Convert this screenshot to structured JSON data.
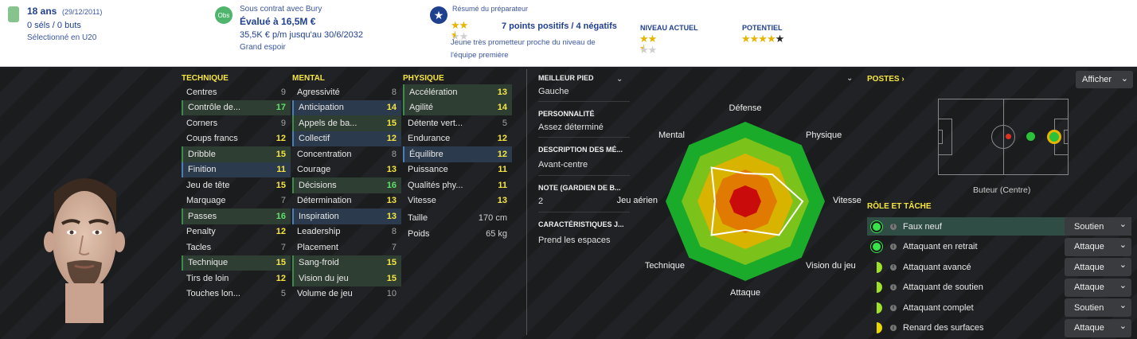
{
  "header": {
    "age": "18 ans",
    "dob": "(29/12/2011)",
    "caps": "0 séls / 0 buts",
    "selection": "Sélectionné en U20",
    "obs_badge": "Obs",
    "contract_line": "Sous contrat avec Bury",
    "valuation": "Évalué à 16,5M €",
    "wage": "35,5K € p/m jusqu'au 30/6/2032",
    "status": "Grand espoir",
    "coach_report_label": "Résumé du préparateur",
    "coach_summary": "7 points positifs / 4 négatifs",
    "coach_desc_1": "Jeune très prometteur proche du niveau de",
    "coach_desc_2": "l'équipe première",
    "coach_stars": 2.5,
    "current_label": "NIVEAU ACTUEL",
    "current_stars": 2.5,
    "potential_label": "POTENTIEL",
    "potential_stars": 4.5
  },
  "attributes": {
    "technique_label": "TECHNIQUE",
    "mental_label": "MENTAL",
    "physique_label": "PHYSIQUE",
    "technique": [
      {
        "name": "Centres",
        "value": "9",
        "style": "gry"
      },
      {
        "name": "Contrôle de...",
        "value": "17",
        "style": "grn",
        "hl": "g"
      },
      {
        "name": "Corners",
        "value": "9",
        "style": "gry"
      },
      {
        "name": "Coups francs",
        "value": "12",
        "style": "yel"
      },
      {
        "name": "Dribble",
        "value": "15",
        "style": "yel",
        "hl": "g"
      },
      {
        "name": "Finition",
        "value": "11",
        "style": "yel",
        "hl": "b"
      },
      {
        "name": "Jeu de tête",
        "value": "15",
        "style": "yel"
      },
      {
        "name": "Marquage",
        "value": "7",
        "style": "gry"
      },
      {
        "name": "Passes",
        "value": "16",
        "style": "grn",
        "hl": "g"
      },
      {
        "name": "Penalty",
        "value": "12",
        "style": "yel"
      },
      {
        "name": "Tacles",
        "value": "7",
        "style": "gry"
      },
      {
        "name": "Technique",
        "value": "15",
        "style": "yel",
        "hl": "g"
      },
      {
        "name": "Tirs de loin",
        "value": "12",
        "style": "yel"
      },
      {
        "name": "Touches lon...",
        "value": "5",
        "style": "gry"
      }
    ],
    "mental": [
      {
        "name": "Agressivité",
        "value": "8",
        "style": "gry"
      },
      {
        "name": "Anticipation",
        "value": "14",
        "style": "yel",
        "hl": "b"
      },
      {
        "name": "Appels de ba...",
        "value": "15",
        "style": "yel",
        "hl": "g"
      },
      {
        "name": "Collectif",
        "value": "12",
        "style": "yel",
        "hl": "b"
      },
      {
        "name": "Concentration",
        "value": "8",
        "style": "gry"
      },
      {
        "name": "Courage",
        "value": "13",
        "style": "yel"
      },
      {
        "name": "Décisions",
        "value": "16",
        "style": "grn",
        "hl": "g"
      },
      {
        "name": "Détermination",
        "value": "13",
        "style": "yel"
      },
      {
        "name": "Inspiration",
        "value": "13",
        "style": "yel",
        "hl": "b"
      },
      {
        "name": "Leadership",
        "value": "8",
        "style": "gry"
      },
      {
        "name": "Placement",
        "value": "7",
        "style": "gry"
      },
      {
        "name": "Sang-froid",
        "value": "15",
        "style": "yel",
        "hl": "g"
      },
      {
        "name": "Vision du jeu",
        "value": "15",
        "style": "yel",
        "hl": "g"
      },
      {
        "name": "Volume de jeu",
        "value": "10",
        "style": "gry"
      }
    ],
    "physique": [
      {
        "name": "Accélération",
        "value": "13",
        "style": "yel",
        "hl": "g"
      },
      {
        "name": "Agilité",
        "value": "14",
        "style": "yel",
        "hl": "g"
      },
      {
        "name": "Détente vert...",
        "value": "5",
        "style": "gry"
      },
      {
        "name": "Endurance",
        "value": "12",
        "style": "yel"
      },
      {
        "name": "Équilibre",
        "value": "12",
        "style": "yel",
        "hl": "b"
      },
      {
        "name": "Puissance",
        "value": "11",
        "style": "yel"
      },
      {
        "name": "Qualités phy...",
        "value": "11",
        "style": "yel"
      },
      {
        "name": "Vitesse",
        "value": "13",
        "style": "yel"
      },
      {
        "name": "Taille",
        "value": "170 cm",
        "style": "white"
      },
      {
        "name": "Poids",
        "value": "65 kg",
        "style": "white"
      }
    ]
  },
  "info": {
    "foot_label": "MEILLEUR PIED",
    "foot_value": "Gauche",
    "personality_label": "PERSONNALITÉ",
    "personality_value": "Assez déterminé",
    "desc_label": "DESCRIPTION DES MÉ...",
    "desc_value": "Avant-centre",
    "gk_label": "NOTE (GARDIEN DE B...",
    "gk_value": "2",
    "traits_label": "CARACTÉRISTIQUES J...",
    "traits_value": "Prend les espaces"
  },
  "radar": {
    "labels": [
      "Défense",
      "Physique",
      "Vitesse",
      "Vision du jeu",
      "Attaque",
      "Technique",
      "Jeu aérien",
      "Mental"
    ],
    "values": [
      0.35,
      0.48,
      0.72,
      0.6,
      0.36,
      0.6,
      0.38,
      0.6
    ],
    "ring_colors": [
      "#1aab2b",
      "#7bc21a",
      "#d8b400",
      "#e07a00",
      "#c90b0b"
    ]
  },
  "positions": {
    "label": "POSTES",
    "display_button": "Afficher",
    "position_name": "Buteur (Centre)"
  },
  "roles": {
    "label": "RÔLE ET TÂCHE",
    "items": [
      {
        "name": "Faux neuf",
        "duty": "Soutien",
        "dot": "full"
      },
      {
        "name": "Attaquant en retrait",
        "duty": "Attaque",
        "dot": "full"
      },
      {
        "name": "Attaquant avancé",
        "duty": "Attaque",
        "dot": "half"
      },
      {
        "name": "Attaquant de soutien",
        "duty": "Attaque",
        "dot": "half"
      },
      {
        "name": "Attaquant complet",
        "duty": "Soutien",
        "dot": "half"
      },
      {
        "name": "Renard des surfaces",
        "duty": "Attaque",
        "dot": "halfy"
      }
    ]
  },
  "colors": {
    "header_text": "#1f3f8f",
    "attr_yellow": "#f5e642",
    "attr_green": "#5fe06b",
    "role_green": "#3ae24a"
  }
}
